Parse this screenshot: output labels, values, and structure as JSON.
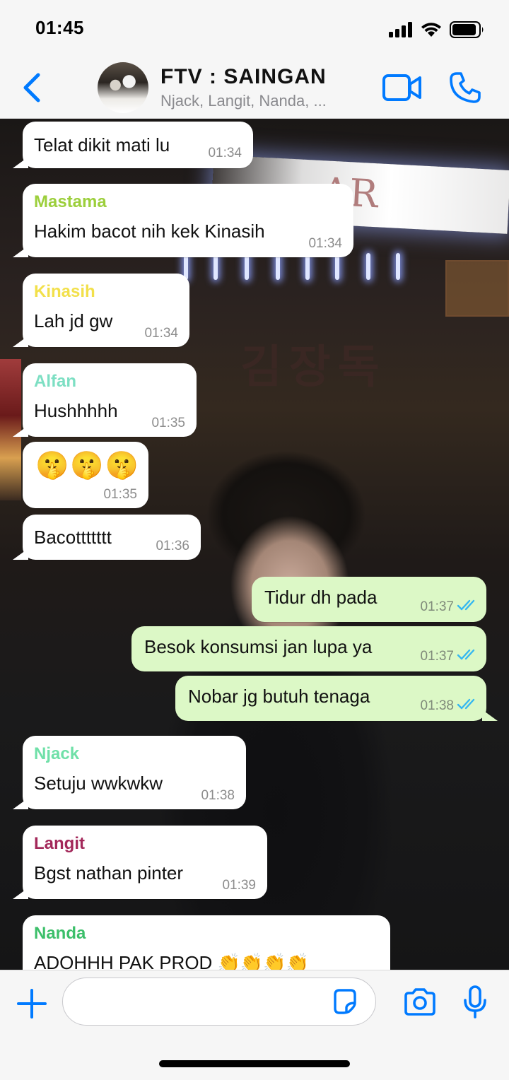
{
  "status_bar": {
    "time": "01:45"
  },
  "header": {
    "title": "FTV : SAINGAN",
    "subtitle": "Njack, Langit, Nanda, ..."
  },
  "messages": [
    {
      "direction": "incoming",
      "sender": "",
      "text": "Telat dikit mati lu",
      "time": "01:34"
    },
    {
      "direction": "incoming",
      "sender": "Mastama",
      "sender_color": "#9ccf3c",
      "text": "Hakim bacot nih kek Kinasih",
      "time": "01:34"
    },
    {
      "direction": "incoming",
      "sender": "Kinasih",
      "sender_color": "#f2e04a",
      "text": "Lah jd gw",
      "time": "01:34"
    },
    {
      "direction": "incoming",
      "sender": "Alfan",
      "sender_color": "#7ddfc3",
      "text": "Hushhhhh",
      "time": "01:35"
    },
    {
      "direction": "incoming",
      "sender": "",
      "text": "🤫🤫🤫",
      "time": "01:35"
    },
    {
      "direction": "incoming",
      "sender": "",
      "text": "Bacottttttt",
      "time": "01:36"
    },
    {
      "direction": "outgoing",
      "text": "Tidur dh pada",
      "time": "01:37",
      "read": true
    },
    {
      "direction": "outgoing",
      "text": "Besok konsumsi jan lupa ya",
      "time": "01:37",
      "read": true
    },
    {
      "direction": "outgoing",
      "text": "Nobar jg butuh tenaga",
      "time": "01:38",
      "read": true
    },
    {
      "direction": "incoming",
      "sender": "Njack",
      "sender_color": "#6fe0a8",
      "text": "Setuju wwkwkw",
      "time": "01:38"
    },
    {
      "direction": "incoming",
      "sender": "Langit",
      "sender_color": "#a3285a",
      "text": "Bgst nathan pinter",
      "time": "01:39"
    },
    {
      "direction": "incoming",
      "sender": "Nanda",
      "sender_color": "#3cbf6a",
      "text": "ADOHHH PAK PROD 👏👏👏👏",
      "time": ""
    }
  ],
  "input": {
    "value": "",
    "placeholder": ""
  },
  "colors": {
    "accent": "#007aff",
    "incoming_bubble": "#ffffff",
    "outgoing_bubble": "#dcf8c6",
    "read_checks": "#34b7f1"
  },
  "icons": {
    "back": "chevron-left-icon",
    "video": "video-camera-icon",
    "call": "phone-icon",
    "attach": "plus-icon",
    "sticker": "sticker-icon",
    "camera": "camera-icon",
    "mic": "microphone-icon"
  }
}
